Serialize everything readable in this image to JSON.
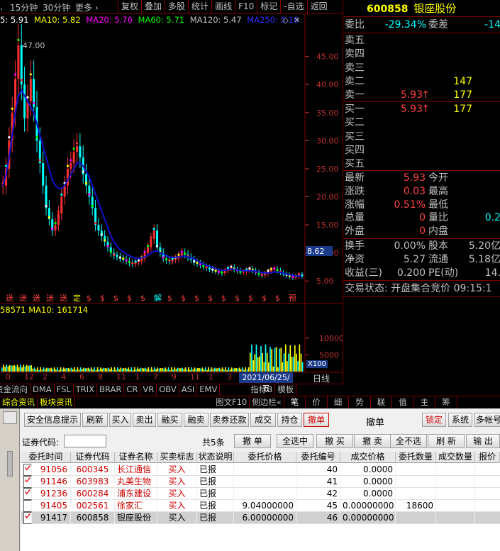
{
  "topbar": {
    "left_text": ",",
    "period_15": "15分钟",
    "period_30": "30分钟",
    "more": "更多 ›",
    "buttons": [
      "复权",
      "叠加",
      "多股",
      "统计",
      "画线",
      "F10",
      "标记",
      "-自选",
      "返回"
    ]
  },
  "ma_legend": [
    {
      "label": "5: 5.91",
      "color": "#ffffff"
    },
    {
      "label": "MA10: 5.82",
      "color": "#ffff00"
    },
    {
      "label": "MA20: 5.76",
      "color": "#ff00ff"
    },
    {
      "label": "MA60: 5.71",
      "color": "#00ff00"
    },
    {
      "label": "MA120: 5.47",
      "color": "#c0c0c0"
    },
    {
      "label": "MA250: 5.16",
      "color": "#0000ff"
    }
  ],
  "chart_data": {
    "type": "candlestick",
    "ylim": [
      2.5,
      49
    ],
    "yticks": [
      45,
      40,
      35,
      30,
      25,
      20,
      15,
      10,
      5
    ],
    "tick_labels": [
      "45.00",
      "40.00",
      "35.00",
      "30.00",
      "25.00",
      "20.00",
      "15.00",
      "10.00",
      "5.00"
    ],
    "peak_label": "47.00",
    "current_price_label": "8.62",
    "close": [
      22,
      25,
      30,
      35,
      41,
      47,
      40,
      34,
      37,
      41,
      36,
      30,
      26,
      22,
      18,
      16,
      14,
      15,
      17,
      20,
      22,
      25,
      26,
      28,
      29,
      27,
      24,
      22,
      20,
      18,
      15,
      14,
      13,
      12,
      11,
      10,
      9.5,
      9.3,
      9,
      8.8,
      8.5,
      8.2,
      8,
      8.3,
      8.5,
      9,
      10,
      11,
      12.5,
      14,
      11,
      10,
      9,
      8.7,
      8.5,
      8.8,
      9,
      9.5,
      10,
      9.7,
      9.2,
      8.8,
      8.3,
      8.1,
      7.8,
      7.5,
      7.3,
      7.1,
      6.9,
      6.7,
      6.5,
      6.4,
      6.8,
      7.2,
      7.4,
      7,
      6.8,
      6.5,
      6.6,
      6.9,
      7.1,
      6.8,
      6.5,
      6.2,
      6,
      6.3,
      6.7,
      7,
      7.1,
      6.8,
      6.5,
      6.2,
      6,
      5.8,
      5.6,
      5.8,
      6.1,
      5.9
    ],
    "ma250": [
      22,
      24,
      27,
      31,
      35,
      38,
      39,
      38,
      37,
      36,
      35,
      33,
      31,
      29,
      27,
      25,
      23,
      22,
      21.5,
      21.5,
      22,
      23,
      24,
      25,
      26,
      26,
      25.5,
      24.5,
      23.5,
      22,
      20.5,
      19,
      17.5,
      16,
      14.5,
      13,
      12,
      11.2,
      10.6,
      10.2,
      9.8,
      9.5,
      9.2,
      9,
      9,
      9.1,
      9.3,
      9.6,
      10,
      10.3,
      10.3,
      10.1,
      9.8,
      9.5,
      9.3,
      9.2,
      9.2,
      9.3,
      9.4,
      9.4,
      9.3,
      9.1,
      8.9,
      8.6,
      8.3,
      8,
      7.8,
      7.6,
      7.4,
      7.2,
      7,
      6.9,
      6.9,
      7,
      7.1,
      7.1,
      7,
      6.9,
      6.8,
      6.8,
      6.8,
      6.8,
      6.7,
      6.6,
      6.5,
      6.4,
      6.4,
      6.5,
      6.6,
      6.6,
      6.5,
      6.4,
      6.2,
      6.1,
      6,
      5.9,
      5.9,
      5.8
    ],
    "markers": [
      "送",
      "送",
      "送",
      "送",
      "送",
      "定",
      "$",
      "$",
      "$",
      "$",
      "$",
      "解",
      "$",
      "$",
      "$",
      "$",
      "$",
      "$",
      "$",
      "$",
      "$",
      "预"
    ],
    "volume_label": "58571  MA10: 161714",
    "volume_ticks": [
      "10000",
      "5000"
    ],
    "volume_unit": "X100",
    "x_labels": [
      "0",
      "12",
      "2",
      "4",
      "6",
      "8",
      "11",
      "1",
      "7",
      "9",
      "11",
      "1",
      "3"
    ],
    "date_label": "2021/06/25/五",
    "x_period": "日线"
  },
  "tabs1": [
    "资金流向",
    "DMA",
    "FSL",
    "TRIX",
    "BRAR",
    "CR",
    "VR",
    "OBV",
    "ASI",
    "EMV",
    "指标B",
    "模板"
  ],
  "tabs2": [
    "综合资讯",
    "板块资讯",
    "图文F10",
    "侧边栏«",
    "笔",
    "价",
    "细",
    "势",
    "联",
    "值",
    "主",
    "筹"
  ],
  "quote": {
    "code": "600858",
    "name": "银座股份",
    "weibi_label": "委比",
    "weibi": "-29.34%",
    "weicha_label": "委差",
    "weicha": "-14",
    "sell": [
      {
        "l": "卖五",
        "p": "",
        "v": ""
      },
      {
        "l": "卖四",
        "p": "",
        "v": ""
      },
      {
        "l": "卖三",
        "p": "",
        "v": ""
      },
      {
        "l": "卖二",
        "p": "",
        "v": "147"
      },
      {
        "l": "卖一",
        "p": "5.93",
        "arrow": "↑",
        "v": "177"
      }
    ],
    "buy": [
      {
        "l": "买一",
        "p": "5.93",
        "arrow": "↑",
        "v": "177"
      },
      {
        "l": "买二",
        "p": "",
        "v": ""
      },
      {
        "l": "买三",
        "p": "",
        "v": ""
      },
      {
        "l": "买四",
        "p": "",
        "v": ""
      },
      {
        "l": "买五",
        "p": "",
        "v": ""
      }
    ],
    "stats": [
      {
        "l": "最新",
        "v": "5.93",
        "l2": "今开",
        "v2": ""
      },
      {
        "l": "涨跌",
        "v": "0.03",
        "l2": "最高",
        "v2": ""
      },
      {
        "l": "涨幅",
        "v": "0.51%",
        "l2": "最低",
        "v2": ""
      },
      {
        "l": "总量",
        "v": "0",
        "l2": "量比",
        "v2": "0.2"
      },
      {
        "l": "外盘",
        "v": "0",
        "l2": "内盘",
        "v2": ""
      }
    ],
    "stats2": [
      {
        "l": "换手",
        "v": "0.00%",
        "l2": "股本",
        "v2": "5.20亿"
      },
      {
        "l": "净资",
        "v": "5.27",
        "l2": "流通",
        "v2": "5.18亿"
      },
      {
        "l": "收益(三)",
        "v": "0.200",
        "l2": "PE(动)",
        "v2": "14."
      }
    ],
    "status": "交易状态: 开盘集合竞价 09:15:1"
  },
  "trade": {
    "toolbar": [
      "安全信息提示",
      "刷新",
      "买入",
      "卖出",
      "融买",
      "融卖",
      "卖券还款",
      "成交",
      "持仓",
      "撤单"
    ],
    "title": "撤单",
    "lock": "锁定",
    "system": "系统",
    "multi": "多帐号",
    "code_label": "证券代码:",
    "count": "共5条",
    "actions": [
      "撤 单",
      "全选中",
      "撤 买",
      "撤 卖",
      "全不选",
      "刷 新",
      "输 出"
    ],
    "headers": [
      "委托时间",
      "证券代码",
      "证券名称",
      "买卖标志",
      "状态说明",
      "委托价格",
      "委托编号",
      "成交价格",
      "委托数量",
      "成交数量",
      "报价"
    ],
    "rows": [
      {
        "checked": true,
        "time": "91056",
        "code": "600345",
        "name": "长江通信",
        "side": "买入",
        "status": "已报",
        "price": "",
        "no": "40",
        "deal": "0.0000",
        "qty": "",
        "dqty": "",
        "sel": false
      },
      {
        "checked": true,
        "time": "91146",
        "code": "603983",
        "name": "丸美生物",
        "side": "买入",
        "status": "已报",
        "price": "",
        "no": "41",
        "deal": "0.0000",
        "qty": "",
        "dqty": "",
        "sel": false
      },
      {
        "checked": true,
        "time": "91236",
        "code": "600284",
        "name": "浦东建设",
        "side": "买入",
        "status": "已报",
        "price": "",
        "no": "42",
        "deal": "0.0000",
        "qty": "",
        "dqty": "",
        "sel": false
      },
      {
        "checked": false,
        "time": "91405",
        "code": "002561",
        "name": "徐家汇",
        "side": "买入",
        "status": "已报",
        "price": "9.04000000",
        "no": "45",
        "deal": "0.00000000",
        "qty": "18600",
        "dqty": "",
        "sel": false
      },
      {
        "checked": true,
        "time": "91417",
        "code": "600858",
        "name": "银座股份",
        "side": "买入",
        "status": "已报",
        "price": "6.00000000",
        "no": "46",
        "deal": "0.00000000",
        "qty": "",
        "dqty": "",
        "sel": true
      }
    ]
  }
}
